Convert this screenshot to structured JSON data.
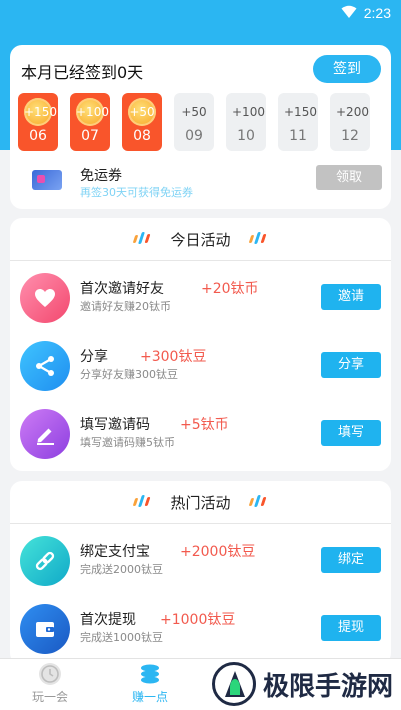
{
  "status_bar": {
    "time": "2:23"
  },
  "signin": {
    "title": "本月已经签到0天",
    "sign_button": "签到",
    "days": [
      {
        "coin": "+150",
        "day": "06",
        "state": "active"
      },
      {
        "coin": "+100",
        "day": "07",
        "state": "active"
      },
      {
        "coin": "+50",
        "day": "08",
        "state": "active"
      },
      {
        "coin": "+50",
        "day": "09",
        "state": "inactive"
      },
      {
        "coin": "+100",
        "day": "10",
        "state": "inactive"
      },
      {
        "coin": "+150",
        "day": "11",
        "state": "inactive"
      },
      {
        "coin": "+200",
        "day": "12",
        "state": "inactive"
      }
    ],
    "coupon": {
      "title": "免运券",
      "subtitle": "再签30天可获得免运券",
      "button": "领取"
    }
  },
  "today": {
    "title": "今日活动",
    "items": [
      {
        "name": "首次邀请好友",
        "reward": "+20钛币",
        "desc": "邀请好友赚20钛币",
        "button": "邀请",
        "icon": "heart-icon"
      },
      {
        "name": "分享",
        "reward": "+300钛豆",
        "desc": "分享好友赚300钛豆",
        "button": "分享",
        "icon": "share-icon"
      },
      {
        "name": "填写邀请码",
        "reward": "+5钛币",
        "desc": "填写邀请码赚5钛币",
        "button": "填写",
        "icon": "pen-icon"
      }
    ]
  },
  "hot": {
    "title": "热门活动",
    "items": [
      {
        "name": "绑定支付宝",
        "reward": "+2000钛豆",
        "desc": "完成送2000钛豆",
        "button": "绑定",
        "icon": "link-icon"
      },
      {
        "name": "首次提现",
        "reward": "+1000钛豆",
        "desc": "完成送1000钛豆",
        "button": "提现",
        "icon": "wallet-icon"
      }
    ]
  },
  "bottom_nav": {
    "items": [
      {
        "label": "玩一会",
        "icon": "clock-icon"
      },
      {
        "label": "赚一点",
        "icon": "coins-icon"
      }
    ]
  },
  "watermark": {
    "text": "极限手游网"
  },
  "colors": {
    "primary": "#2bb6f2",
    "active_day": "#f9552b",
    "reward": "#f25a4e"
  }
}
